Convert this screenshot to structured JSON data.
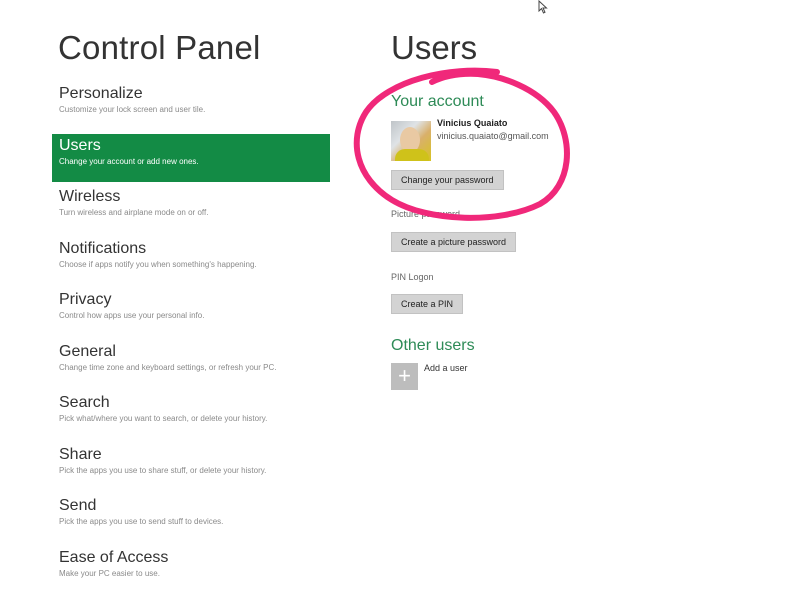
{
  "left_panel": {
    "title": "Control Panel",
    "items": [
      {
        "label": "Personalize",
        "desc": "Customize your lock screen and user tile."
      },
      {
        "label": "Users",
        "desc": "Change your account or add new ones.",
        "selected": true
      },
      {
        "label": "Wireless",
        "desc": "Turn wireless and airplane mode on or off."
      },
      {
        "label": "Notifications",
        "desc": "Choose if apps notify you when something's happening."
      },
      {
        "label": "Privacy",
        "desc": "Control how apps use your personal info."
      },
      {
        "label": "General",
        "desc": "Change time zone and keyboard settings, or refresh your PC."
      },
      {
        "label": "Search",
        "desc": "Pick what/where you want to search, or delete your history."
      },
      {
        "label": "Share",
        "desc": "Pick the apps you use to share stuff, or delete your history."
      },
      {
        "label": "Send",
        "desc": "Pick the apps you use to send stuff to devices."
      },
      {
        "label": "Ease of Access",
        "desc": "Make your PC easier to use."
      }
    ]
  },
  "right_panel": {
    "title": "Users",
    "your_account": {
      "heading": "Your account",
      "user_name": "Vinicius Quaiato",
      "user_email": "vinicius.quaiato@gmail.com",
      "change_password_label": "Change your password"
    },
    "picture_password": {
      "label": "Picture password",
      "button_label": "Create a picture password"
    },
    "pin_logon": {
      "label": "PIN Logon",
      "button_label": "Create a PIN"
    },
    "other_users": {
      "heading": "Other users",
      "add_icon": "+",
      "add_label": "Add a user"
    }
  },
  "colors": {
    "accent_green": "#138b45",
    "heading_green": "#2e8b57",
    "annotation_magenta": "#f0287a"
  },
  "icons": {
    "cursor": "mouse-pointer-icon",
    "add": "plus-icon"
  }
}
